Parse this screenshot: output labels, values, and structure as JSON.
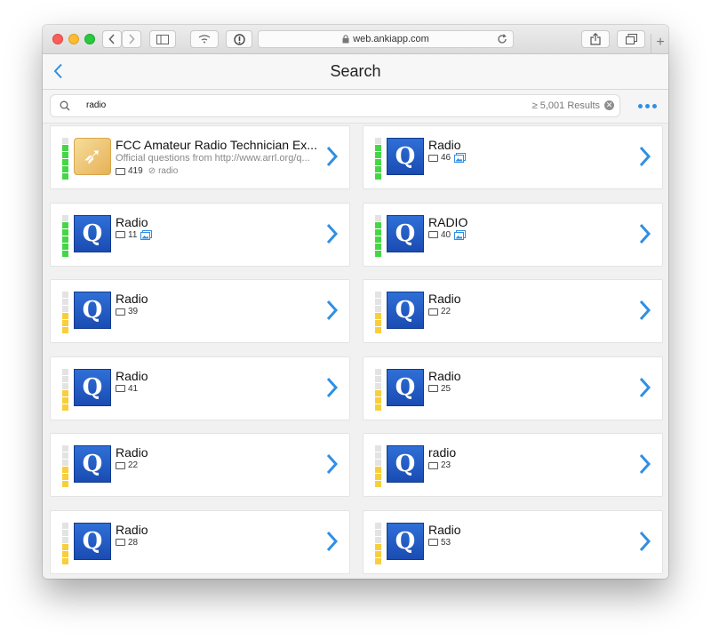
{
  "browser": {
    "url": "web.ankiapp.com"
  },
  "navbar": {
    "title": "Search"
  },
  "search": {
    "query": "radio",
    "result_count": "≥ 5,001 Results"
  },
  "colors": {
    "accent": "#2f8fe3",
    "level_green": "#45d645",
    "level_yellow": "#f8cf3b",
    "deck_icon_blue": "#1f5cc4"
  },
  "results": [
    {
      "title": "FCC Amateur Radio Technician Ex...",
      "subtitle": "Official questions from http://www.arrl.org/q...",
      "cards": "419",
      "tag": "radio",
      "icon": "fcc-deck-icon",
      "level": "green",
      "has_images": false
    },
    {
      "title": "Radio",
      "cards": "46",
      "icon": "q-deck-icon",
      "level": "green",
      "has_images": true
    },
    {
      "title": "Radio",
      "cards": "11",
      "icon": "q-deck-icon",
      "level": "green",
      "has_images": true
    },
    {
      "title": "RADIO",
      "cards": "40",
      "icon": "q-deck-icon",
      "level": "green",
      "has_images": true
    },
    {
      "title": "Radio",
      "cards": "39",
      "icon": "q-deck-icon",
      "level": "yellow",
      "has_images": false
    },
    {
      "title": "Radio",
      "cards": "22",
      "icon": "q-deck-icon",
      "level": "yellow",
      "has_images": false
    },
    {
      "title": "Radio",
      "cards": "41",
      "icon": "q-deck-icon",
      "level": "yellow",
      "has_images": false
    },
    {
      "title": "Radio",
      "cards": "25",
      "icon": "q-deck-icon",
      "level": "yellow",
      "has_images": false
    },
    {
      "title": "Radio",
      "cards": "22",
      "icon": "q-deck-icon",
      "level": "yellow",
      "has_images": false
    },
    {
      "title": "radio",
      "cards": "23",
      "icon": "q-deck-icon",
      "level": "yellow",
      "has_images": false
    },
    {
      "title": "Radio",
      "cards": "28",
      "icon": "q-deck-icon",
      "level": "yellow",
      "has_images": false
    },
    {
      "title": "Radio",
      "cards": "53",
      "icon": "q-deck-icon",
      "level": "yellow",
      "has_images": false
    }
  ]
}
